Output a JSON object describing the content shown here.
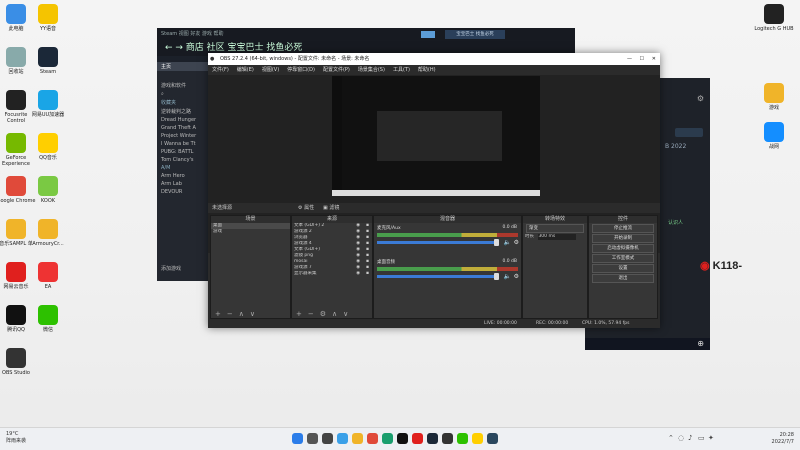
{
  "desktop_icons_left": [
    {
      "label": "此电脑",
      "icon": "computer-icon",
      "color": "#3a8ee6"
    },
    {
      "label": "YY语音",
      "icon": "yy-icon",
      "color": "#f5c400"
    },
    {
      "label": "回收站",
      "icon": "recycle-bin-icon",
      "color": "#8aa"
    },
    {
      "label": "Steam",
      "icon": "steam-icon",
      "color": "#1b2838"
    },
    {
      "label": "Focusrite Control",
      "icon": "focusrite-icon",
      "color": "#222"
    },
    {
      "label": "网易UU加速器",
      "icon": "uu-icon",
      "color": "#1aa5e6"
    },
    {
      "label": "GeForce Experience",
      "icon": "geforce-icon",
      "color": "#76b900"
    },
    {
      "label": "QQ音乐",
      "icon": "qq-music-icon",
      "color": "#ffcf00"
    },
    {
      "label": "Google Chrome",
      "icon": "chrome-icon",
      "color": "#e04a3a"
    },
    {
      "label": "KOOK",
      "icon": "kook-icon",
      "color": "#7ac943"
    },
    {
      "label": "音乐SAMPL 单",
      "icon": "folder-icon",
      "color": "#f0b429"
    },
    {
      "label": "ArmouryCr...",
      "icon": "folder-icon",
      "color": "#f0b429"
    },
    {
      "label": "网易云音乐",
      "icon": "netease-music-icon",
      "color": "#e0201e"
    },
    {
      "label": "EA",
      "icon": "ea-icon",
      "color": "#e33"
    },
    {
      "label": "腾讯QQ",
      "icon": "qq-icon",
      "color": "#111"
    },
    {
      "label": "微信",
      "icon": "wechat-icon",
      "color": "#2dc100"
    },
    {
      "label": "OBS Studio",
      "icon": "obs-icon",
      "color": "#333"
    }
  ],
  "desktop_icons_right": [
    {
      "label": "Logitech G HUB",
      "icon": "logitech-icon",
      "color": "#222"
    },
    {
      "label": "游戏",
      "icon": "folder-icon",
      "color": "#f0b429"
    },
    {
      "label": "战网",
      "icon": "battlenet-icon",
      "color": "#148eff"
    }
  ],
  "weibo_watermark": "K118-",
  "steam": {
    "titlebar": "Steam  视图  好友  游戏  帮助",
    "nav": "←  →  商店  社区  宝宝巴士 找鱼必死",
    "user_badge": "宝宝巴士 找鱼必死",
    "home_label": "主页",
    "library_title": "游戏和软件",
    "search_placeholder": "",
    "collection_header": "收藏夹",
    "games": [
      "逆转裁判之路",
      "Dread Hunger",
      "Grand Theft A",
      "Project Winter",
      "I Wanna be Tt",
      "PUBG: BATTL",
      "Tom Clancy's"
    ],
    "group_b": "— B",
    "group_ai": "A/M",
    "games_b": [
      "Arm Hero",
      "Arm Lab"
    ],
    "devour": "DEVOUR",
    "add_game": "添加游戏"
  },
  "friends": {
    "year": "B 2022",
    "ad_label": "认识人"
  },
  "obs": {
    "title": "OBS 27.2.4 (64-bit, windows) - 配置文件: 未命名 - 场景: 未命名",
    "menu": [
      "文件(F)",
      "编辑(E)",
      "视图(V)",
      "停靠窗口(D)",
      "配置文件(P)",
      "场景集合(S)",
      "工具(T)",
      "帮助(H)"
    ],
    "source_toolbar": [
      "⚙ 属性",
      "▣ 滤镜"
    ],
    "no_source_selected": "未选择源",
    "docks": {
      "scenes": {
        "header": "场景",
        "items": [
          "桌面",
          "游戏"
        ]
      },
      "sources": {
        "header": "来源",
        "items": [
          "文本 (GDI+) 2",
          "游戏源 2",
          "浏览器",
          "游戏源 4",
          "文本 (GDI+)",
          "滤镜 png",
          "mosai",
          "游戏源 7",
          "显示器采集"
        ]
      },
      "mixer": {
        "header": "混音器",
        "tracks": [
          {
            "name": "麦克风/Aux",
            "db": "0.0 dB"
          },
          {
            "name": "桌面音频",
            "db": "0.0 dB"
          }
        ]
      },
      "transitions": {
        "header": "转场特效",
        "type": "渐变",
        "duration_label": "时长",
        "duration": "300 ms"
      },
      "controls": {
        "header": "控件",
        "buttons": [
          "停止推流",
          "开始录制",
          "启动虚拟摄像机",
          "工作室模式",
          "设置",
          "退出"
        ]
      }
    },
    "status": {
      "live": "LIVE: 00:00:00",
      "rec": "REC: 00:00:00",
      "cpu": "CPU: 1.0%, 57.94 fps"
    }
  },
  "taskbar": {
    "weather_temp": "19°C",
    "weather_desc": "阵雨来袭",
    "time": "20:28",
    "date": "2022/7/7"
  },
  "colors": {
    "obs_bg": "#2b2b2b",
    "steam_bg": "#1b2029",
    "meter_green": "#4caf50",
    "meter_yellow": "#d8c23a",
    "meter_red": "#c0392b"
  }
}
